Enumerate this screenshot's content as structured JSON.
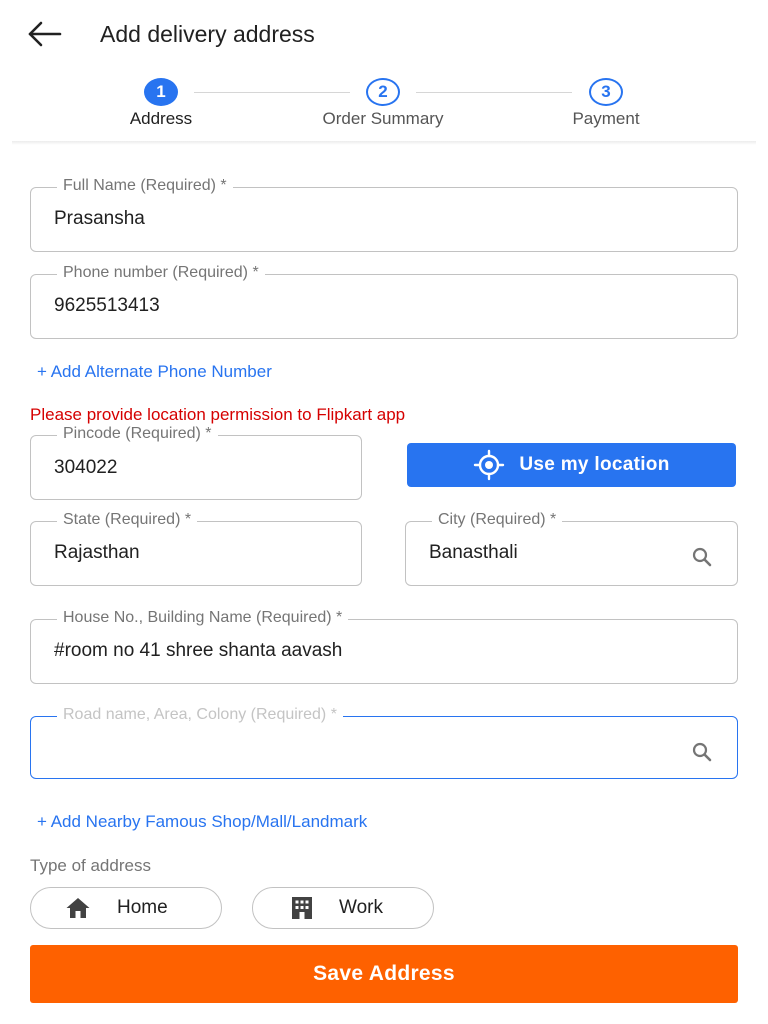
{
  "header": {
    "title": "Add delivery address"
  },
  "stepper": {
    "steps": [
      {
        "number": "1",
        "label": "Address"
      },
      {
        "number": "2",
        "label": "Order Summary"
      },
      {
        "number": "3",
        "label": "Payment"
      }
    ],
    "active_step": 1
  },
  "form": {
    "full_name": {
      "label": "Full Name (Required) *",
      "value": "Prasansha"
    },
    "phone": {
      "label": "Phone number (Required) *",
      "value": "9625513413"
    },
    "add_alternate_phone": "+ Add Alternate Phone Number",
    "location_error": "Please provide location permission to Flipkart app",
    "pincode": {
      "label": "Pincode (Required) *",
      "value": "304022"
    },
    "use_location": "Use my location",
    "state": {
      "label": "State (Required) *",
      "value": "Rajasthan"
    },
    "city": {
      "label": "City (Required) *",
      "value": "Banasthali"
    },
    "house": {
      "label": "House No., Building Name (Required) *",
      "value": "#room no 41 shree shanta aavash"
    },
    "road": {
      "label": "Road name, Area, Colony (Required) *",
      "value": ""
    },
    "add_landmark": "+ Add Nearby Famous Shop/Mall/Landmark",
    "address_type": {
      "title": "Type of address",
      "options": [
        {
          "label": "Home",
          "icon": "home-icon"
        },
        {
          "label": "Work",
          "icon": "building-icon"
        }
      ]
    },
    "save_button": "Save Address"
  },
  "colors": {
    "primary_blue": "#2874f0",
    "save_orange": "#fe6100",
    "error_red": "#d50000",
    "border_gray": "#c2c2c2"
  }
}
